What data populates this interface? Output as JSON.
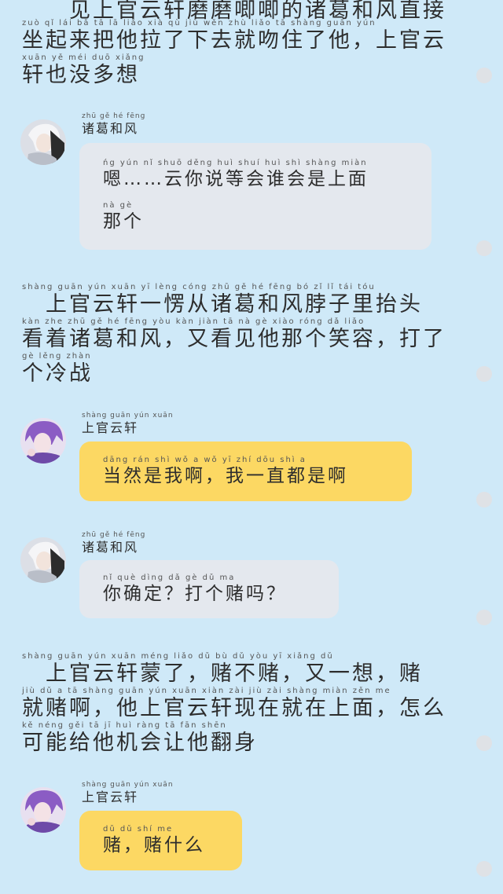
{
  "colors": {
    "background": "#cfe9f8",
    "gray_bubble": "#e4e8ee",
    "yellow_bubble": "#fcd863",
    "dot": "#dfe2e6"
  },
  "narration": [
    {
      "lines": [
        {
          "pinyin": "",
          "text": "见上官云轩磨磨唧唧的诸葛和风直接"
        },
        {
          "pinyin": "zuò qǐ   lái  bǎ   tā    lā  liǎo xià  qù   jiù  wěn  zhù  liǎo  tā              shàng guān yún",
          "text": "坐起来把他拉了下去就吻住了他，上官云"
        },
        {
          "pinyin": "xuān  yě   méi  duō  xiǎng",
          "text": "轩也没多想"
        }
      ]
    },
    {
      "lines": [
        {
          "pinyin": "   shàng guān  yún xuān  yī   lèng cóng  zhū   gě    hé   fēng   bó    zǐ     lǐ    tái   tóu",
          "text": "　上官云轩一愣从诸葛和风脖子里抬头"
        },
        {
          "pinyin": "kàn  zhe  zhū   gě    hé   fēng         yòu  kàn  jiàn  tā    nà   gè  xiào róng         dǎ   liǎo",
          "text": "看着诸葛和风，又看见他那个笑容，打了"
        },
        {
          "pinyin": "gè  lěng zhàn",
          "text": "个冷战"
        }
      ]
    },
    {
      "lines": [
        {
          "pinyin": "   shàng guān  yún xuān méng liǎo          dǔ    bù    dǔ           yòu   yī  xiǎng          dǔ",
          "text": "　上官云轩蒙了，赌不赌，又一想，赌"
        },
        {
          "pinyin": "jiù   dǔ    a          tā shàng guān yún xuān xiàn zài  jiù  zài shàng miàn        zěn  me",
          "text": "就赌啊，他上官云轩现在就在上面，怎么"
        },
        {
          "pinyin": "kě  néng gěi   tā    jī   huì  ràng  tā   fān  shēn",
          "text": "可能给他机会让他翻身"
        }
      ]
    }
  ],
  "messages": [
    {
      "speaker": "zhuge",
      "name_pinyin": "zhū   gě   hé  fēng",
      "name": "诸葛和风",
      "bubble": "gray",
      "lines": [
        {
          "pinyin": "ńg                yún  nǐ  shuō děng huì shuí huì  shì shàng miàn",
          "text": "嗯……云你说等会谁会是上面"
        },
        {
          "pinyin": "nà   gè",
          "text": "那个"
        }
      ]
    },
    {
      "speaker": "shangguan",
      "name_pinyin": "shàng guān yún xuān",
      "name": "上官云轩",
      "bubble": "yellow",
      "lines": [
        {
          "pinyin": "dāng rán  shì  wǒ    a            wǒ   yī   zhí  dōu  shì   a",
          "text": "当然是我啊，我一直都是啊"
        }
      ]
    },
    {
      "speaker": "zhuge",
      "name_pinyin": "zhū   gě   hé  fēng",
      "name": "诸葛和风",
      "bubble": "gray",
      "lines": [
        {
          "pinyin": "nǐ  què  dìng        dǎ   gè   dǔ   ma",
          "text": "你确定？打个赌吗？"
        }
      ]
    },
    {
      "speaker": "shangguan",
      "name_pinyin": "shàng guān yún xuān",
      "name": "上官云轩",
      "bubble": "yellow",
      "lines": [
        {
          "pinyin": "dǔ         dǔ  shí   me",
          "text": "赌，赌什么"
        }
      ]
    }
  ]
}
